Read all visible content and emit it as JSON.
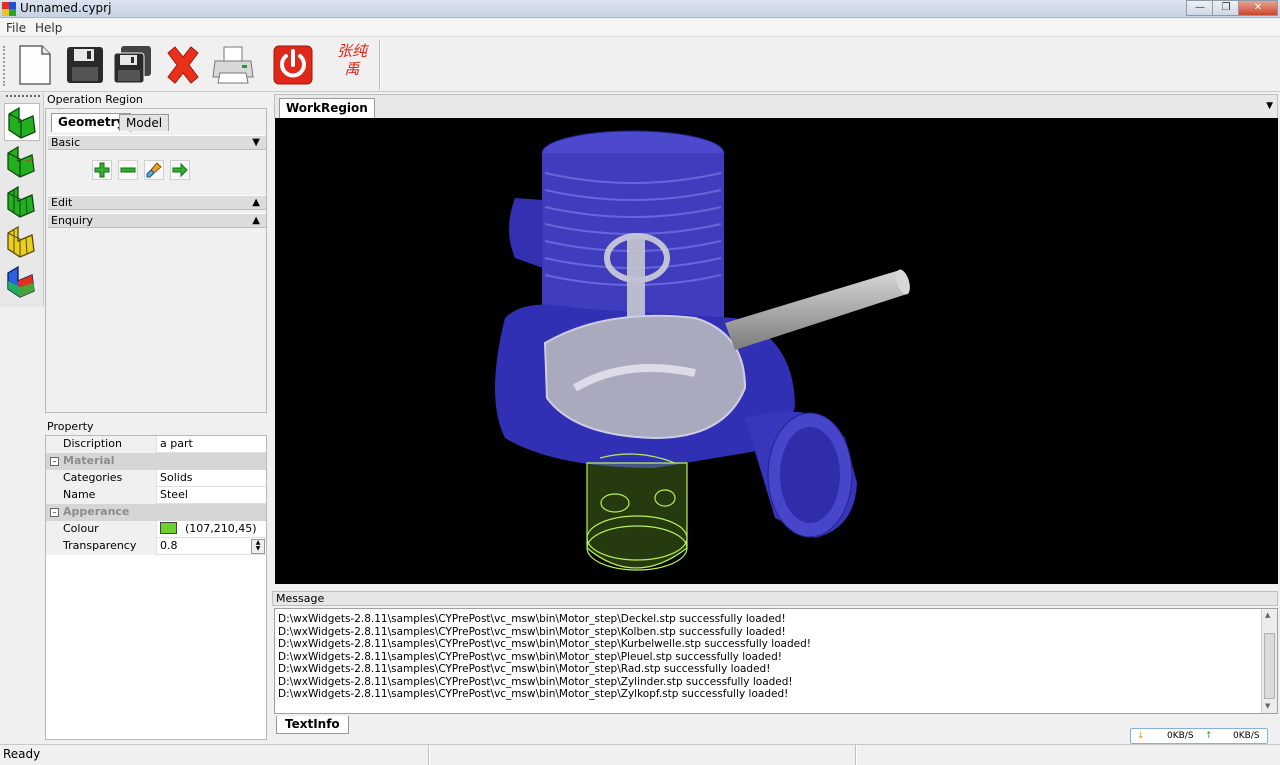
{
  "window": {
    "title": "Unnamed.cyprj"
  },
  "menu": [
    "File",
    "Help"
  ],
  "toolbar": {
    "buttons": [
      "new-icon",
      "save-icon",
      "save-all-icon",
      "delete-icon",
      "print-icon",
      "power-icon"
    ],
    "logo_text": "张纯禹"
  },
  "operation_region": {
    "title": "Operation Region",
    "tabs": [
      "Geometry",
      "Model"
    ],
    "sections": {
      "basic": "Basic",
      "edit": "Edit",
      "enquiry": "Enquiry"
    },
    "basic_buttons": [
      "add-icon",
      "remove-icon",
      "brush-icon",
      "arrow-right-icon"
    ]
  },
  "property": {
    "title": "Property",
    "discription_key": "Discription",
    "discription_val": "a part",
    "material": "Material",
    "categories_key": "Categories",
    "categories_val": "Solids",
    "name_key": "Name",
    "name_val": "Steel",
    "apperance": "Apperance",
    "colour_key": "Colour",
    "colour_val": "(107,210,45)",
    "colour_hex": "#6bd22d",
    "transparency_key": "Transparency",
    "transparency_val": "0.8"
  },
  "work_region": {
    "tab": "WorkRegion"
  },
  "message": {
    "title": "Message",
    "tab": "TextInfo",
    "lines": [
      "D:\\wxWidgets-2.8.11\\samples\\CYPrePost\\vc_msw\\bin\\Motor_step\\Deckel.stp successfully loaded!",
      "D:\\wxWidgets-2.8.11\\samples\\CYPrePost\\vc_msw\\bin\\Motor_step\\Kolben.stp successfully loaded!",
      "D:\\wxWidgets-2.8.11\\samples\\CYPrePost\\vc_msw\\bin\\Motor_step\\Kurbelwelle.stp successfully loaded!",
      "D:\\wxWidgets-2.8.11\\samples\\CYPrePost\\vc_msw\\bin\\Motor_step\\Pleuel.stp successfully loaded!",
      "D:\\wxWidgets-2.8.11\\samples\\CYPrePost\\vc_msw\\bin\\Motor_step\\Rad.stp successfully loaded!",
      "D:\\wxWidgets-2.8.11\\samples\\CYPrePost\\vc_msw\\bin\\Motor_step\\Zylinder.stp successfully loaded!",
      "D:\\wxWidgets-2.8.11\\samples\\CYPrePost\\vc_msw\\bin\\Motor_step\\Zylkopf.stp successfully loaded!"
    ]
  },
  "status": {
    "text": "Ready",
    "down": "0KB/S",
    "up": "0KB/S"
  },
  "colors": {
    "viewport_bg": "#000000",
    "cylinder_blue": "#4a48e0",
    "shaft_gray": "#b8b8b8",
    "green_part": "#9cdc4c"
  }
}
